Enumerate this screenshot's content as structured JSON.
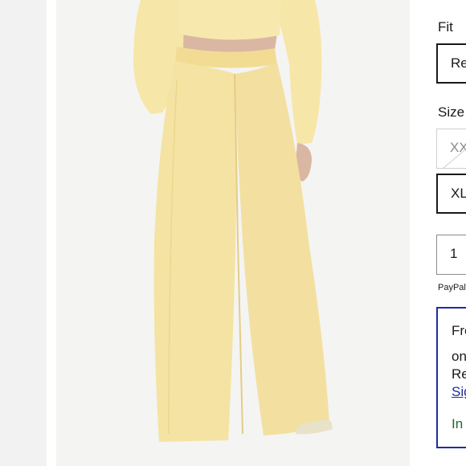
{
  "product": {
    "image_alt": "Yellow wide-leg sweatpants, back view",
    "colors": {
      "fabric": "#f5e3a3",
      "accent": "#1f2ca0",
      "in_stock": "#1f6b2c"
    }
  },
  "options": {
    "fit_label": "Fit",
    "fit_selected": "Re",
    "size_label": "Size",
    "sizes": [
      {
        "label": "XX",
        "state": "unavailable"
      },
      {
        "label": "XL",
        "state": "available"
      }
    ],
    "quantity": "1"
  },
  "payment": {
    "paypal_text": "PayPal"
  },
  "promo": {
    "line1": "Fre",
    "line2": "on",
    "line3": "Re",
    "link_text": "Sig",
    "stock_text": "In"
  }
}
